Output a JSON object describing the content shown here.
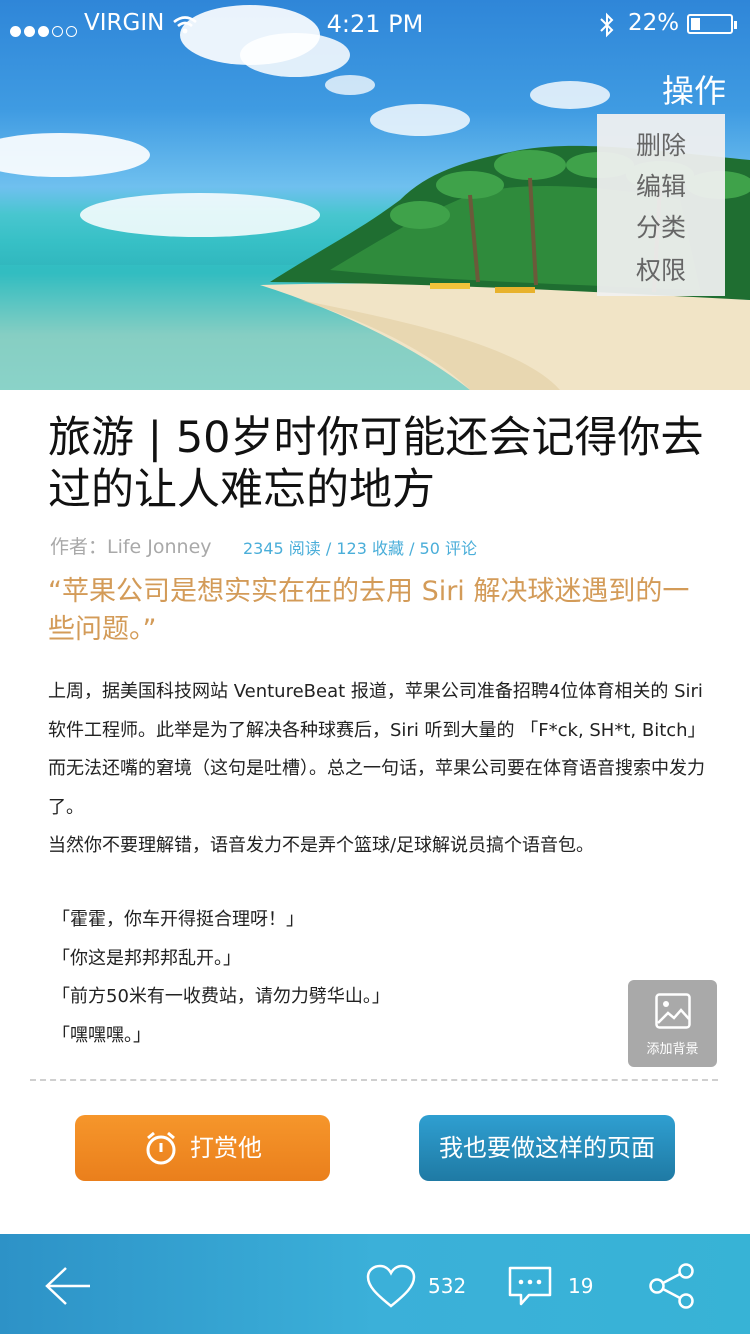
{
  "status_bar": {
    "carrier": "VIRGIN",
    "time": "4:21 PM",
    "battery": "22%",
    "battery_level": 0.22
  },
  "hero": {
    "ops_title": "操作",
    "ops_menu": [
      "删除",
      "编辑",
      "分类",
      "权限"
    ]
  },
  "article": {
    "title": "旅游 | 50岁时你可能还会记得你去过的让人难忘的地方",
    "author": "作者：Life Jonney",
    "stats": "2345 阅读  / 123 收藏  /  50 评论",
    "quote": "“苹果公司是想实实在在的去用 Siri 解决球迷遇到的一些问题。”",
    "paragraphs": [
      "上周，据美国科技网站 VentureBeat 报道，苹果公司准备招聘4位体育相关的 Siri 软件工程师。此举是为了解决各种球赛后，Siri 听到大量的 「F*ck, SH*t, Bitch」 而无法还嘴的窘境（这句是吐槽）。总之一句话，苹果公司要在体育语音搜索中发力了。",
      "当然你不要理解错，语音发力不是弄个篮球/足球解说员搞个语音包。"
    ],
    "lines": [
      "「霍霍，你车开得挺合理呀！」",
      "「你这是邦邦邦乱开。」",
      "「前方50米有一收费站，请勿力劈华山。」",
      "「嘿嘿嘿。」"
    ]
  },
  "add_background": {
    "label": "添加背景"
  },
  "buttons": {
    "reward": "打赏他",
    "make_page": "我也要做这样的页面"
  },
  "bottom_bar": {
    "likes": "532",
    "comments": "19"
  },
  "colors": {
    "accent_blue": "#2d92c7",
    "reward_orange": "#f08a22",
    "quote_gold": "#d39b58",
    "stats_blue": "#4aaed9"
  }
}
